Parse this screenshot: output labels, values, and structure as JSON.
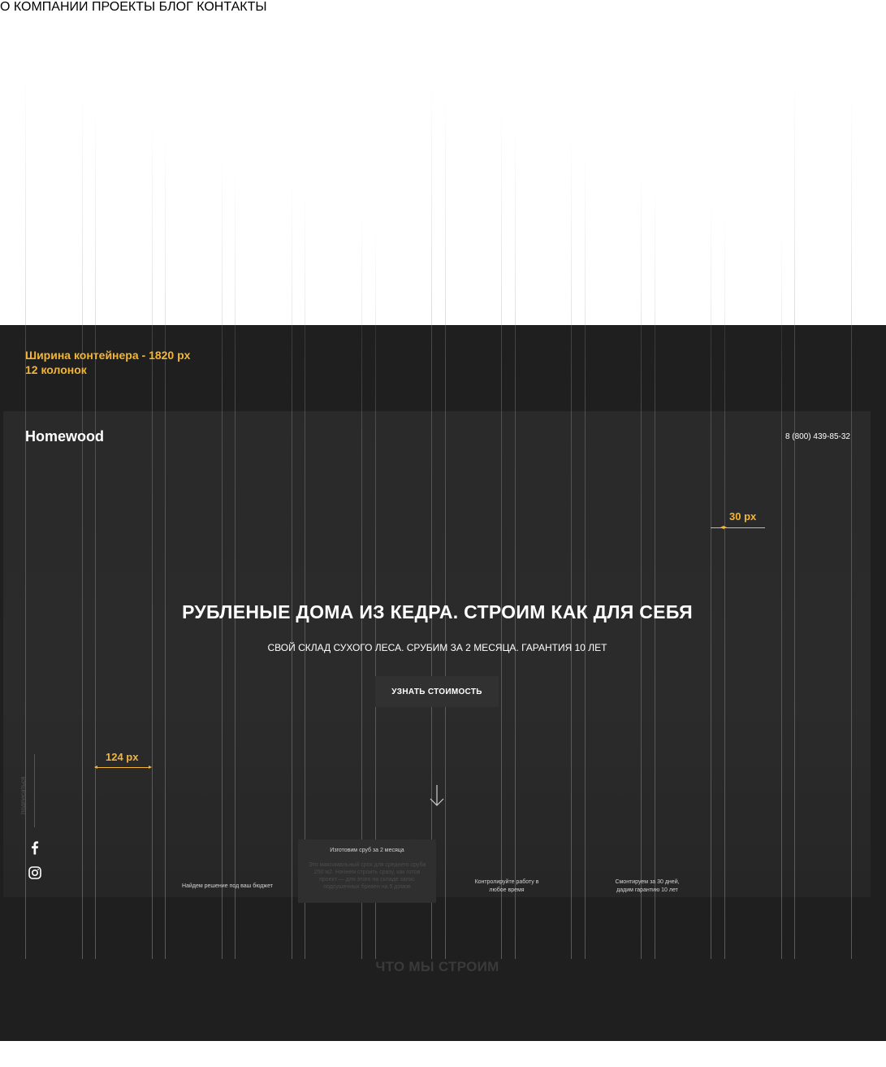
{
  "spec": {
    "container_width": "Ширина контейнера - 1820 px",
    "columns": "12 колонок"
  },
  "header": {
    "logo": "Homewood",
    "nav": [
      "О КОМПАНИИ",
      "ПРОЕКТЫ",
      "БЛОГ",
      "КОНТАКТЫ"
    ],
    "phone": "8 (800) 439-85-32"
  },
  "annotations": {
    "gutter": "30 px",
    "column": "124 px"
  },
  "hero": {
    "title": "РУБЛЕНЫЕ ДОМА ИЗ КЕДРА. СТРОИМ КАК ДЛЯ СЕБЯ",
    "subtitle": "СВОЙ СКЛАД СУХОГО ЛЕСА. СРУБИМ ЗА 2 МЕСЯЦА. ГАРАНТИЯ 10 ЛЕТ",
    "cta": "УЗНАТЬ СТОИМОСТЬ"
  },
  "sidebar": {
    "subscribe": "подписаться",
    "icons": [
      "facebook-icon",
      "instagram-icon"
    ]
  },
  "features": [
    {
      "title": "Найдем решение под ваш бюджет"
    },
    {
      "title": "Изготовим сруб за 2 месяца",
      "desc": "Это максимальный срок для среднего сруба 250 м2. Начнем строить сразу, как готов проект — для этого на складе запас подсушенных бревен на 5 домов"
    },
    {
      "title": "Контролируйте работу в любое время"
    },
    {
      "title": "Смонтируем за 30 дней, дадим гарантию 10 лет"
    }
  ],
  "section": {
    "title": "ЧТО МЫ СТРОИМ"
  },
  "colors": {
    "accent": "#f5b534",
    "background": "#1f1f1f",
    "panel": "#2a2a2a"
  }
}
